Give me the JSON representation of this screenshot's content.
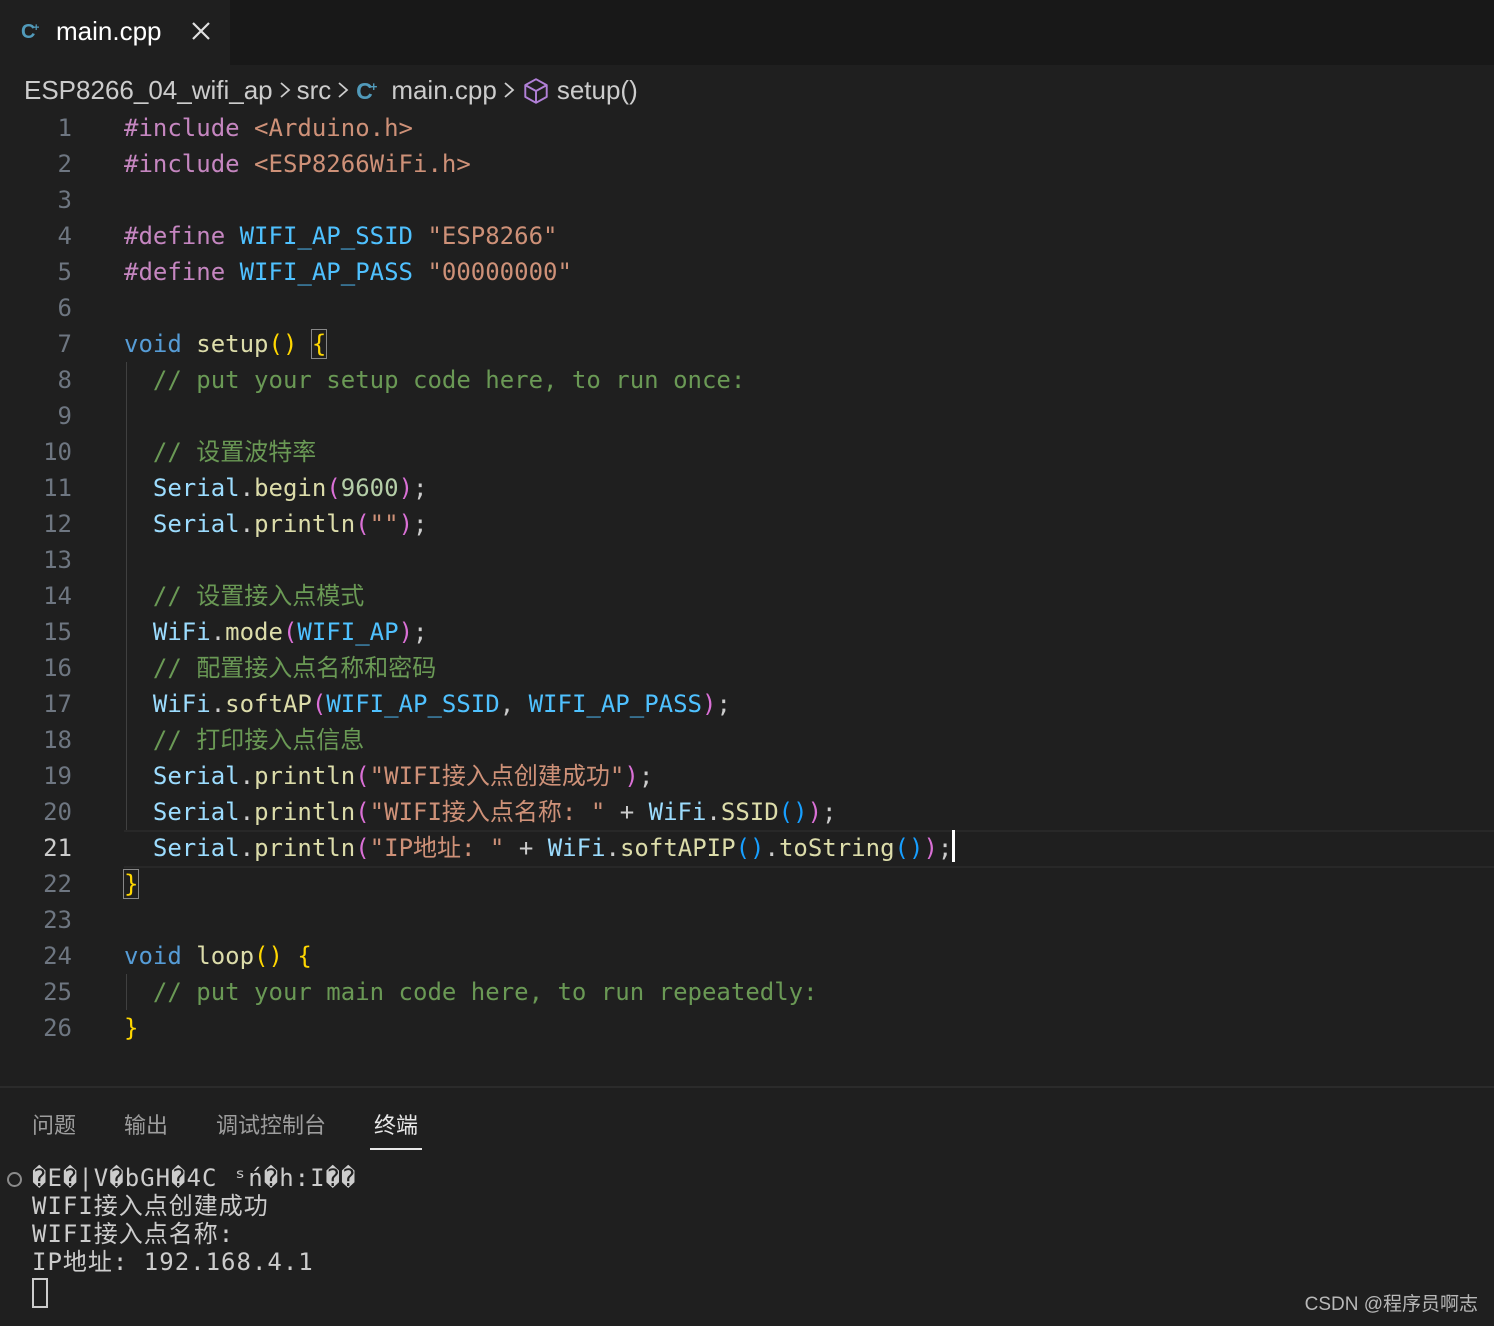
{
  "tab": {
    "label": "main.cpp"
  },
  "breadcrumb": {
    "project": "ESP8266_04_wifi_ap",
    "folder": "src",
    "file": "main.cpp",
    "symbol": "setup()"
  },
  "editor": {
    "current_line": 21,
    "lines": [
      {
        "n": "1",
        "tokens": [
          {
            "t": "#include ",
            "c": "kw-pre"
          },
          {
            "t": "<Arduino.h>",
            "c": "inc"
          }
        ]
      },
      {
        "n": "2",
        "tokens": [
          {
            "t": "#include ",
            "c": "kw-pre"
          },
          {
            "t": "<ESP8266WiFi.h>",
            "c": "inc"
          }
        ]
      },
      {
        "n": "3",
        "tokens": []
      },
      {
        "n": "4",
        "tokens": [
          {
            "t": "#define ",
            "c": "kw-pre"
          },
          {
            "t": "WIFI_AP_SSID",
            "c": "macro"
          },
          {
            "t": " "
          },
          {
            "t": "\"ESP8266\"",
            "c": "str"
          }
        ]
      },
      {
        "n": "5",
        "tokens": [
          {
            "t": "#define ",
            "c": "kw-pre"
          },
          {
            "t": "WIFI_AP_PASS",
            "c": "macro"
          },
          {
            "t": " "
          },
          {
            "t": "\"00000000\"",
            "c": "str"
          }
        ]
      },
      {
        "n": "6",
        "tokens": []
      },
      {
        "n": "7",
        "tokens": [
          {
            "t": "void",
            "c": "kw"
          },
          {
            "t": " "
          },
          {
            "t": "setup",
            "c": "fn"
          },
          {
            "t": "()",
            "c": "p1"
          },
          {
            "t": " "
          },
          {
            "t": "{",
            "c": "p1 brace-box"
          }
        ]
      },
      {
        "n": "8",
        "tokens": [
          {
            "t": "  "
          },
          {
            "t": "// put your setup code here, to run once:",
            "c": "cmt"
          }
        ]
      },
      {
        "n": "9",
        "tokens": []
      },
      {
        "n": "10",
        "tokens": [
          {
            "t": "  "
          },
          {
            "t": "// 设置波特率",
            "c": "cmt"
          }
        ]
      },
      {
        "n": "11",
        "tokens": [
          {
            "t": "  "
          },
          {
            "t": "Serial",
            "c": "var"
          },
          {
            "t": "."
          },
          {
            "t": "begin",
            "c": "fn"
          },
          {
            "t": "(",
            "c": "p2"
          },
          {
            "t": "9600",
            "c": "num"
          },
          {
            "t": ")",
            "c": "p2"
          },
          {
            "t": ";"
          }
        ]
      },
      {
        "n": "12",
        "tokens": [
          {
            "t": "  "
          },
          {
            "t": "Serial",
            "c": "var"
          },
          {
            "t": "."
          },
          {
            "t": "println",
            "c": "fn"
          },
          {
            "t": "(",
            "c": "p2"
          },
          {
            "t": "\"\"",
            "c": "str"
          },
          {
            "t": ")",
            "c": "p2"
          },
          {
            "t": ";"
          }
        ]
      },
      {
        "n": "13",
        "tokens": []
      },
      {
        "n": "14",
        "tokens": [
          {
            "t": "  "
          },
          {
            "t": "// 设置接入点模式",
            "c": "cmt"
          }
        ]
      },
      {
        "n": "15",
        "tokens": [
          {
            "t": "  "
          },
          {
            "t": "WiFi",
            "c": "var"
          },
          {
            "t": "."
          },
          {
            "t": "mode",
            "c": "fn"
          },
          {
            "t": "(",
            "c": "p2"
          },
          {
            "t": "WIFI_AP",
            "c": "macro"
          },
          {
            "t": ")",
            "c": "p2"
          },
          {
            "t": ";"
          }
        ]
      },
      {
        "n": "16",
        "tokens": [
          {
            "t": "  "
          },
          {
            "t": "// 配置接入点名称和密码",
            "c": "cmt"
          }
        ]
      },
      {
        "n": "17",
        "tokens": [
          {
            "t": "  "
          },
          {
            "t": "WiFi",
            "c": "var"
          },
          {
            "t": "."
          },
          {
            "t": "softAP",
            "c": "fn"
          },
          {
            "t": "(",
            "c": "p2"
          },
          {
            "t": "WIFI_AP_SSID",
            "c": "macro"
          },
          {
            "t": ", "
          },
          {
            "t": "WIFI_AP_PASS",
            "c": "macro"
          },
          {
            "t": ")",
            "c": "p2"
          },
          {
            "t": ";"
          }
        ]
      },
      {
        "n": "18",
        "tokens": [
          {
            "t": "  "
          },
          {
            "t": "// 打印接入点信息",
            "c": "cmt"
          }
        ]
      },
      {
        "n": "19",
        "tokens": [
          {
            "t": "  "
          },
          {
            "t": "Serial",
            "c": "var"
          },
          {
            "t": "."
          },
          {
            "t": "println",
            "c": "fn"
          },
          {
            "t": "(",
            "c": "p2"
          },
          {
            "t": "\"WIFI接入点创建成功\"",
            "c": "str"
          },
          {
            "t": ")",
            "c": "p2"
          },
          {
            "t": ";"
          }
        ]
      },
      {
        "n": "20",
        "tokens": [
          {
            "t": "  "
          },
          {
            "t": "Serial",
            "c": "var"
          },
          {
            "t": "."
          },
          {
            "t": "println",
            "c": "fn"
          },
          {
            "t": "(",
            "c": "p2"
          },
          {
            "t": "\"WIFI接入点名称: \"",
            "c": "str"
          },
          {
            "t": " + "
          },
          {
            "t": "WiFi",
            "c": "var"
          },
          {
            "t": "."
          },
          {
            "t": "SSID",
            "c": "fn"
          },
          {
            "t": "()",
            "c": "p3"
          },
          {
            "t": ")",
            "c": "p2"
          },
          {
            "t": ";"
          }
        ]
      },
      {
        "n": "21",
        "tokens": [
          {
            "t": "  "
          },
          {
            "t": "Serial",
            "c": "var"
          },
          {
            "t": "."
          },
          {
            "t": "println",
            "c": "fn"
          },
          {
            "t": "(",
            "c": "p2"
          },
          {
            "t": "\"IP地址: \"",
            "c": "str"
          },
          {
            "t": " + "
          },
          {
            "t": "WiFi",
            "c": "var"
          },
          {
            "t": "."
          },
          {
            "t": "softAPIP",
            "c": "fn"
          },
          {
            "t": "()",
            "c": "p3"
          },
          {
            "t": "."
          },
          {
            "t": "toString",
            "c": "fn"
          },
          {
            "t": "()",
            "c": "p3"
          },
          {
            "t": ")",
            "c": "p2"
          },
          {
            "t": ";"
          }
        ]
      },
      {
        "n": "22",
        "tokens": [
          {
            "t": "}",
            "c": "p1 brace-box"
          }
        ]
      },
      {
        "n": "23",
        "tokens": []
      },
      {
        "n": "24",
        "tokens": [
          {
            "t": "void",
            "c": "kw"
          },
          {
            "t": " "
          },
          {
            "t": "loop",
            "c": "fn"
          },
          {
            "t": "()",
            "c": "p1"
          },
          {
            "t": " "
          },
          {
            "t": "{",
            "c": "p1"
          }
        ]
      },
      {
        "n": "25",
        "tokens": [
          {
            "t": "  "
          },
          {
            "t": "// put your main code here, to run repeatedly:",
            "c": "cmt"
          }
        ]
      },
      {
        "n": "26",
        "tokens": [
          {
            "t": "}",
            "c": "p1"
          }
        ]
      }
    ]
  },
  "panel": {
    "tabs": [
      {
        "label": "问题"
      },
      {
        "label": "输出"
      },
      {
        "label": "调试控制台"
      },
      {
        "label": "终端"
      }
    ],
    "active_tab": "终端",
    "terminal_lines": [
      "�E�|V�bGH�4C ‎ˢń�h:I��",
      "WIFI接入点创建成功",
      "WIFI接入点名称:",
      "IP地址: 192.168.4.1"
    ]
  },
  "watermark": "CSDN @程序员啊志",
  "colors": {
    "background": "#1f1f1f",
    "tabbar": "#181818",
    "keyword": "#569cd6",
    "comment": "#6a9955",
    "string": "#ce9178"
  }
}
